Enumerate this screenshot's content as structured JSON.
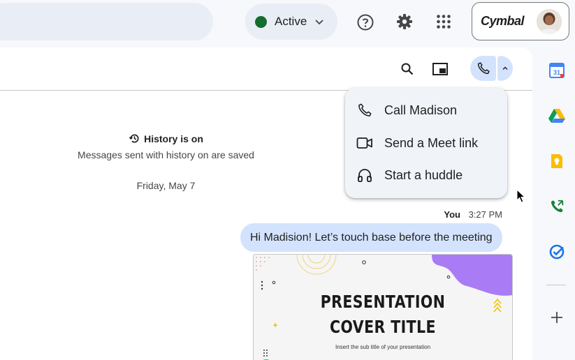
{
  "topbar": {
    "status_label": "Active",
    "brand": "Cymbal",
    "icons": [
      "help-icon",
      "settings-gear-icon",
      "apps-grid-icon",
      "chevron-down-icon"
    ]
  },
  "history": {
    "title": "History is on",
    "subtitle": "Messages sent with history on are saved"
  },
  "date_label": "Friday, May 7",
  "message": {
    "sender": "You",
    "time": "3:27 PM",
    "text": "Hi Madision! Let’s touch base before the meeting"
  },
  "attachment": {
    "title_line1": "PRESENTATION",
    "title_line2": "COVER TITLE",
    "subtitle": "Insert the sub title of your presentation"
  },
  "call_menu": {
    "items": [
      {
        "label": "Call Madison",
        "icon": "phone-icon"
      },
      {
        "label": "Send a Meet link",
        "icon": "video-camera-icon"
      },
      {
        "label": "Start a huddle",
        "icon": "headphones-icon"
      }
    ]
  },
  "colors": {
    "accent": "#d3e3fd",
    "status_green": "#146c2e",
    "background": "#f6f8fc"
  }
}
